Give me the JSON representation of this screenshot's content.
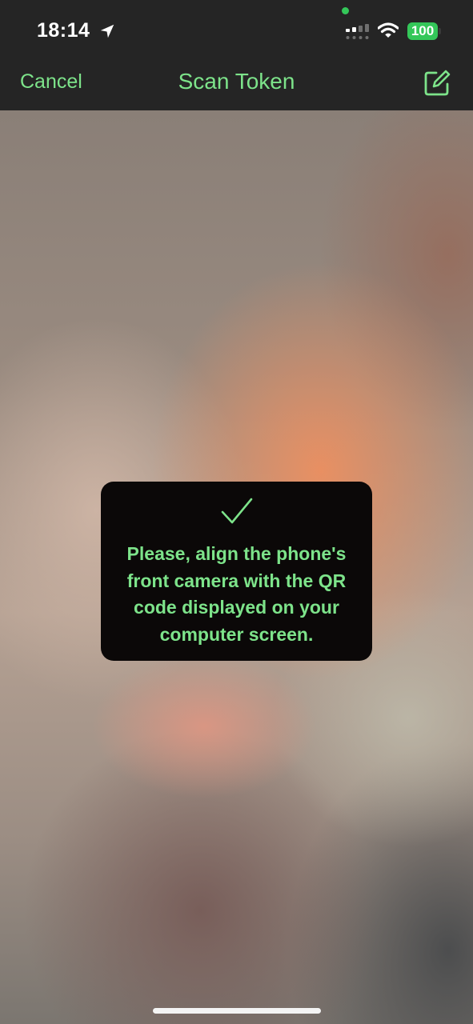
{
  "status_bar": {
    "time": "18:14",
    "battery": "100",
    "icons": [
      "location-arrow-icon",
      "cellular-signal-icon",
      "wifi-icon",
      "battery-icon"
    ]
  },
  "nav": {
    "cancel_label": "Cancel",
    "title": "Scan Token",
    "right_icon": "compose-icon"
  },
  "toast": {
    "icon": "checkmark-icon",
    "message": "Please, align the phone's\nfront camera with the QR\ncode displayed on your\ncomputer screen."
  },
  "colors": {
    "accent": "#7de38a",
    "bar_background": "#252525",
    "toast_background": "#0b0808",
    "battery": "#34c759"
  }
}
